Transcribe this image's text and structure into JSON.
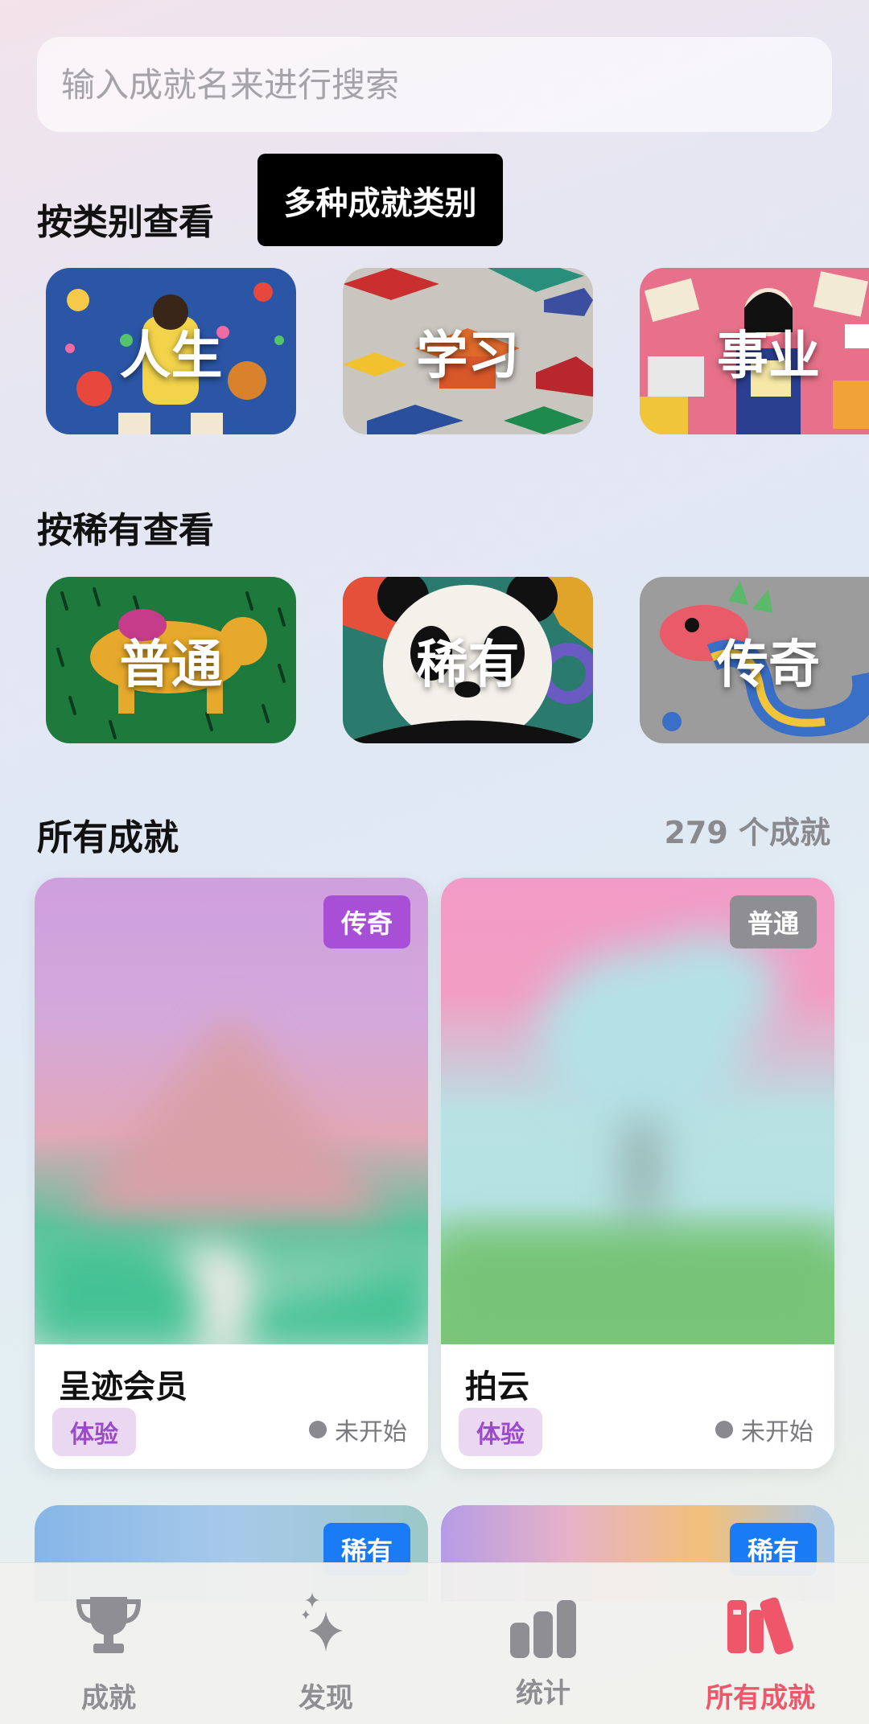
{
  "search": {
    "placeholder": "输入成就名来进行搜索"
  },
  "tooltip": "多种成就类别",
  "sections": {
    "by_category": "按类别查看",
    "by_rarity": "按稀有查看",
    "all": "所有成就",
    "count": "279 个成就"
  },
  "categories": [
    {
      "label": "人生"
    },
    {
      "label": "学习"
    },
    {
      "label": "事业"
    }
  ],
  "rarities": [
    {
      "label": "普通"
    },
    {
      "label": "稀有"
    },
    {
      "label": "传奇"
    }
  ],
  "cards": [
    {
      "name": "呈迹会员",
      "rarity": "传奇",
      "rarity_color": "#a84fd8",
      "tag": "体验",
      "status": "未开始"
    },
    {
      "name": "拍云",
      "rarity": "普通",
      "rarity_color": "#8e8e93",
      "tag": "体验",
      "status": "未开始"
    },
    {
      "rarity": "稀有",
      "rarity_color": "#1a7cf5"
    },
    {
      "rarity": "稀有",
      "rarity_color": "#1a7cf5"
    }
  ],
  "tabs": [
    {
      "label": "成就",
      "icon": "trophy-icon"
    },
    {
      "label": "发现",
      "icon": "sparkles-icon"
    },
    {
      "label": "统计",
      "icon": "bar-chart-icon"
    },
    {
      "label": "所有成就",
      "icon": "books-icon",
      "active": true
    }
  ],
  "colors": {
    "accent": "#f0566a",
    "legend": "#a84fd8",
    "common": "#8e8e93",
    "rare": "#1a7cf5"
  }
}
